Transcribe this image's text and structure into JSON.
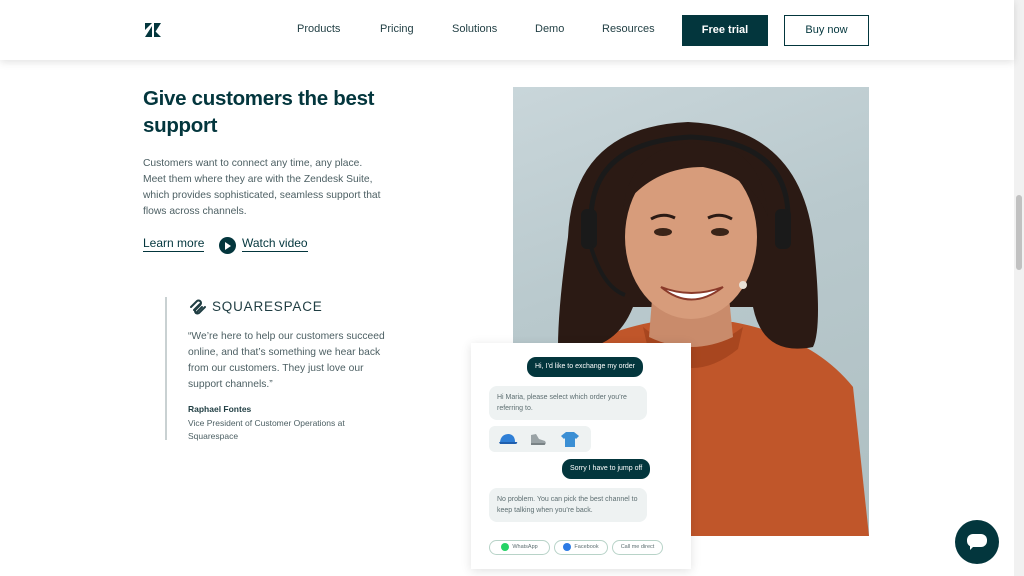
{
  "header": {
    "logo_icon": "zendesk-logo-icon",
    "nav": [
      {
        "label": "Products"
      },
      {
        "label": "Pricing"
      },
      {
        "label": "Solutions"
      },
      {
        "label": "Demo"
      },
      {
        "label": "Resources"
      }
    ],
    "free_trial_label": "Free trial",
    "buy_now_label": "Buy now"
  },
  "hero": {
    "headline": "Give customers the best support",
    "paragraph": "Customers want to connect any time, any place. Meet them where they are with the Zendesk Suite, which provides sophisticated, seamless support that flows across channels.",
    "learn_more": "Learn more",
    "watch_video": "Watch video"
  },
  "testimonial": {
    "company": "SQUARESPACE",
    "quote": "“We’re here to help our customers succeed online, and that’s something we hear back from our customers. They just love our support channels.”",
    "name": "Raphael Fontes",
    "title": "Vice President of Customer Operations at Squarespace"
  },
  "chat": {
    "msg1": "Hi, I’d like to exchange my order",
    "msg2": "Hi Maria, please select which order you’re referring to.",
    "products": [
      "cap-icon",
      "sneaker-icon",
      "tshirt-icon"
    ],
    "msg3": "Sorry I have to jump off",
    "msg4": "No problem. You can pick the best channel to keep talking when you’re back.",
    "channels": [
      {
        "label": "WhatsApp",
        "icon": "whatsapp-icon"
      },
      {
        "label": "Facebook",
        "icon": "messenger-icon"
      },
      {
        "label": "Call me direct"
      }
    ]
  },
  "colors": {
    "brand_dark": "#03363d",
    "text_muted": "#4c5f63",
    "sweater": "#c0562a"
  }
}
